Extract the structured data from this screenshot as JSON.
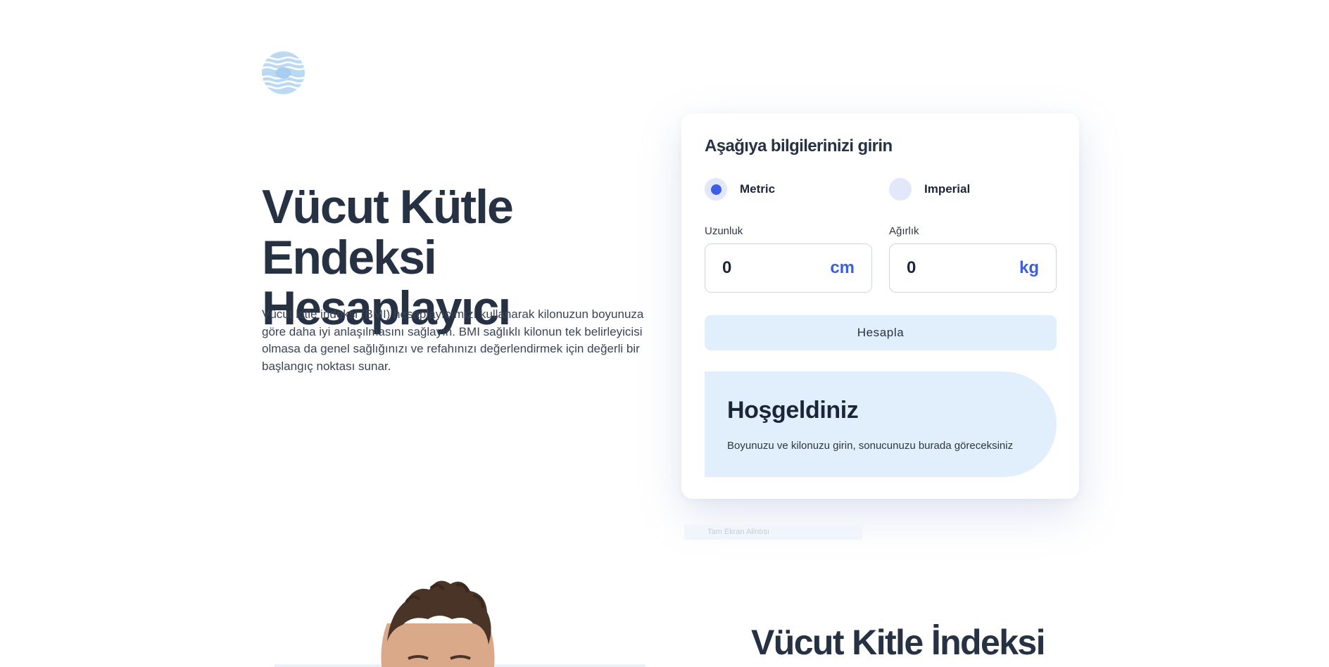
{
  "hero": {
    "title_line1": "Vücut Kütle Endeksi",
    "title_line2": "Hesaplayıcı",
    "description": "Vücut kitle indeksi (BMI) hesaplayıcımızı kullanarak kilonuzun boyunuza göre daha iyi anlaşılmasını sağlayın. BMI sağlıklı kilonun tek belirleyicisi olmasa da genel sağlığınızı ve refahınızı değerlendirmek için değerli bir başlangıç noktası sunar."
  },
  "form": {
    "title": "Aşağıya bilgilerinizi girin",
    "units": [
      {
        "label": "Metric",
        "selected": true
      },
      {
        "label": "Imperial",
        "selected": false
      }
    ],
    "height": {
      "label": "Uzunluk",
      "value": "0",
      "unit": "cm"
    },
    "weight": {
      "label": "Ağırlık",
      "value": "0",
      "unit": "kg"
    },
    "submit_label": "Hesapla",
    "result": {
      "title": "Hoşgeldiniz",
      "text": "Boyunuzu ve kilonuzu girin, sonucunuzu burada göreceksiniz"
    }
  },
  "credit": "Tam Ekran Alintısı",
  "section2": {
    "title": "Vücut Kitle İndeksi"
  },
  "colors": {
    "accent": "#3c5ee6",
    "light_blue": "#e1effc",
    "text_dark": "#263244"
  },
  "icons": {
    "logo": "striped-circle-logo"
  }
}
